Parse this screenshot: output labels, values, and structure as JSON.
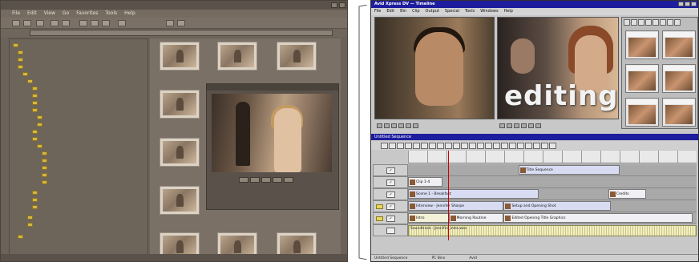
{
  "browser": {
    "title": "",
    "menu": [
      "File",
      "Edit",
      "View",
      "Go",
      "Favorites",
      "Tools",
      "Help"
    ],
    "address_label": "",
    "tree_items": [
      "",
      "",
      "",
      "",
      "",
      "",
      "",
      "",
      "",
      "",
      "",
      "",
      "",
      "",
      "",
      "",
      "",
      "",
      "",
      "",
      "",
      "",
      "",
      "",
      "",
      ""
    ],
    "status": ""
  },
  "editor": {
    "title": "Avid Xpress DV — Timeline",
    "menu": [
      "File",
      "Edit",
      "Bin",
      "Clip",
      "Output",
      "Special",
      "Tools",
      "Windows",
      "Help"
    ],
    "overlay_text": "editing",
    "timeline_title": "Untitled Sequence",
    "tracks": [
      {
        "label": "V4",
        "clips": [
          {
            "name": "Title Sequence",
            "start": 0.38,
            "end": 0.73,
            "style": "blue"
          }
        ]
      },
      {
        "label": "V3",
        "clips": [
          {
            "name": "Clip 1-4",
            "start": 0.0,
            "end": 0.12,
            "style": "plain"
          }
        ]
      },
      {
        "label": "V2",
        "clips": [
          {
            "name": "Scene 1 - Breakfast",
            "start": 0.0,
            "end": 0.45,
            "style": "blue"
          },
          {
            "name": "Credits",
            "start": 0.69,
            "end": 0.82,
            "style": "plain"
          }
        ]
      },
      {
        "label": "V1",
        "clips": [
          {
            "name": "Interview - Jennifer Sharpe",
            "start": 0.0,
            "end": 0.33,
            "style": "blue"
          },
          {
            "name": "Setup and Opening Shot",
            "start": 0.33,
            "end": 0.7,
            "style": "blue"
          }
        ]
      },
      {
        "label": "A1",
        "clips": [
          {
            "name": "Intro",
            "start": 0.0,
            "end": 0.14,
            "style": "cream"
          },
          {
            "name": "Morning Routine",
            "start": 0.14,
            "end": 0.33,
            "style": "plain"
          },
          {
            "name": "Edited Opening Title Graphics",
            "start": 0.33,
            "end": 0.98,
            "style": "plain"
          }
        ]
      }
    ],
    "audio_label": "Soundtrack - Jennifer_intro.wav",
    "status": [
      "Untitled Sequence",
      "PC Bins",
      "Avid"
    ]
  },
  "colors": {
    "browser_bg": "#6b6259",
    "editor_titlebar": "#1d1d9e",
    "folder": "#d6b743"
  }
}
